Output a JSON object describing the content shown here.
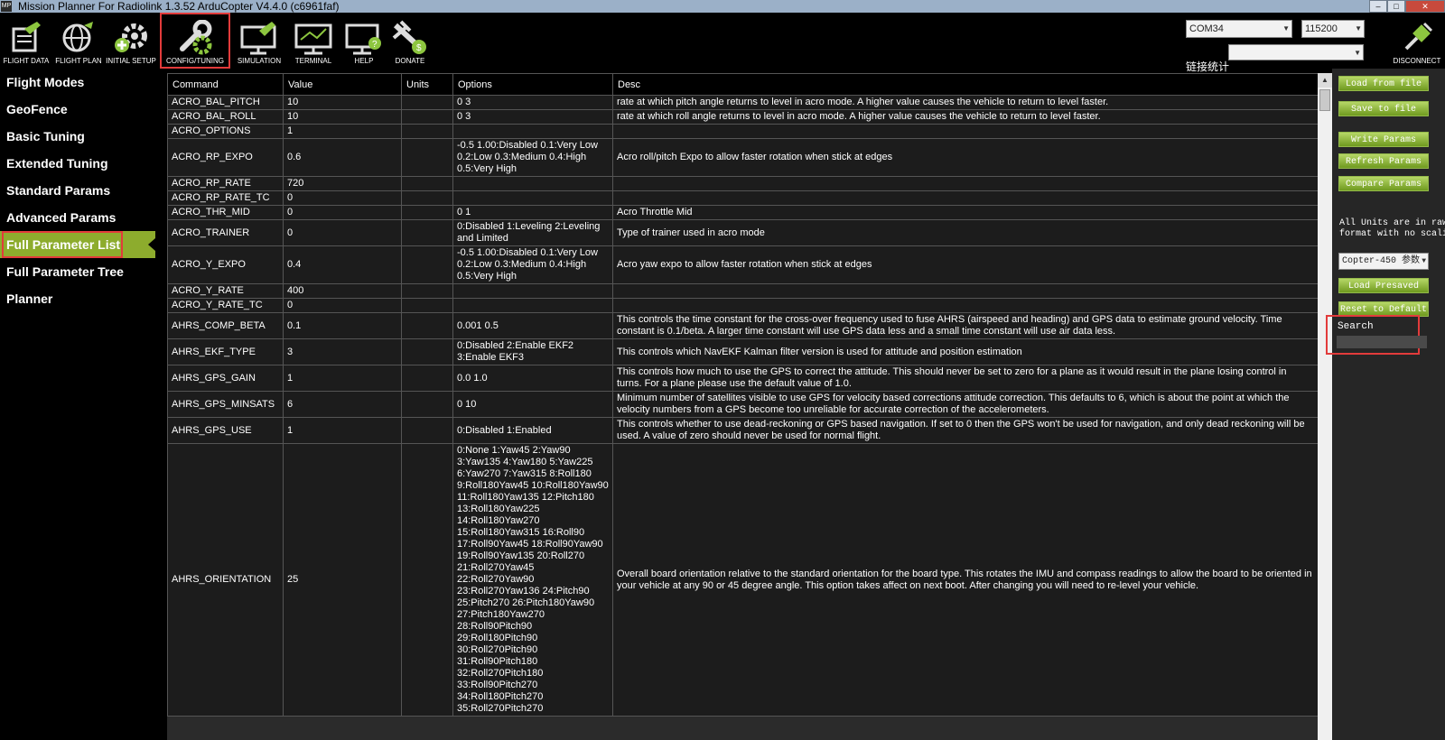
{
  "window": {
    "title": "Mission Planner For Radiolink 1.3.52 ArduCopter V4.4.0 (c6961faf)",
    "app_icon": "MP"
  },
  "toolbar": {
    "buttons": [
      {
        "label": "FLIGHT DATA",
        "icon": "flight-data-icon"
      },
      {
        "label": "FLIGHT PLAN",
        "icon": "flight-plan-icon"
      },
      {
        "label": "INITIAL SETUP",
        "icon": "initial-setup-icon"
      },
      {
        "label": "CONFIG/TUNING",
        "icon": "config-tuning-icon"
      },
      {
        "label": "SIMULATION",
        "icon": "simulation-icon"
      },
      {
        "label": "TERMINAL",
        "icon": "terminal-icon"
      },
      {
        "label": "HELP",
        "icon": "help-icon"
      },
      {
        "label": "DONATE",
        "icon": "donate-icon"
      }
    ],
    "port": "COM34",
    "baud": "115200",
    "stats_label": "链接统计",
    "disconnect_label": "DISCONNECT"
  },
  "sidebar": {
    "items": [
      {
        "label": "Flight Modes"
      },
      {
        "label": "GeoFence"
      },
      {
        "label": "Basic Tuning"
      },
      {
        "label": "Extended Tuning"
      },
      {
        "label": "Standard Params"
      },
      {
        "label": "Advanced Params"
      },
      {
        "label": "Full Parameter List"
      },
      {
        "label": "Full Parameter Tree"
      },
      {
        "label": "Planner"
      }
    ]
  },
  "grid": {
    "columns": [
      "Command",
      "Value",
      "Units",
      "Options",
      "Desc"
    ],
    "rows": [
      {
        "command": "ACRO_BAL_PITCH",
        "value": "10",
        "units": "",
        "options": "0 3",
        "desc": "rate at which pitch angle returns to level in acro mode.  A higher value causes the vehicle to return to level faster."
      },
      {
        "command": "ACRO_BAL_ROLL",
        "value": "10",
        "units": "",
        "options": "0 3",
        "desc": "rate at which roll angle returns to level in acro mode.  A higher value causes the vehicle to return to level faster."
      },
      {
        "command": "ACRO_OPTIONS",
        "value": "1",
        "units": "",
        "options": "",
        "desc": ""
      },
      {
        "command": "ACRO_RP_EXPO",
        "value": "0.6",
        "units": "",
        "options": "-0.5 1.00:Disabled 0.1:Very Low\n0.2:Low 0.3:Medium 0.4:High\n0.5:Very High",
        "desc": "Acro roll/pitch Expo to allow faster rotation when stick at edges"
      },
      {
        "command": "ACRO_RP_RATE",
        "value": "720",
        "units": "",
        "options": "",
        "desc": ""
      },
      {
        "command": "ACRO_RP_RATE_TC",
        "value": "0",
        "units": "",
        "options": "",
        "desc": ""
      },
      {
        "command": "ACRO_THR_MID",
        "value": "0",
        "units": "",
        "options": "0 1",
        "desc": "Acro Throttle Mid"
      },
      {
        "command": "ACRO_TRAINER",
        "value": "0",
        "units": "",
        "options": "0:Disabled 1:Leveling 2:Leveling\nand Limited",
        "desc": "Type of trainer used in acro mode"
      },
      {
        "command": "ACRO_Y_EXPO",
        "value": "0.4",
        "units": "",
        "options": "-0.5 1.00:Disabled 0.1:Very Low\n0.2:Low 0.3:Medium 0.4:High\n0.5:Very High",
        "desc": "Acro yaw expo to allow faster rotation when stick at edges"
      },
      {
        "command": "ACRO_Y_RATE",
        "value": "400",
        "units": "",
        "options": "",
        "desc": ""
      },
      {
        "command": "ACRO_Y_RATE_TC",
        "value": "0",
        "units": "",
        "options": "",
        "desc": ""
      },
      {
        "command": "AHRS_COMP_BETA",
        "value": "0.1",
        "units": "",
        "options": "0.001 0.5",
        "desc": "This controls the time constant for the cross-over frequency used to fuse AHRS (airspeed and heading) and GPS data to estimate ground velocity. Time constant is 0.1/beta. A larger time constant will use GPS data less and a small time constant will use air data less."
      },
      {
        "command": "AHRS_EKF_TYPE",
        "value": "3",
        "units": "",
        "options": "0:Disabled 2:Enable EKF2\n3:Enable EKF3",
        "desc": "This controls which NavEKF Kalman filter version is used for attitude and position estimation"
      },
      {
        "command": "AHRS_GPS_GAIN",
        "value": "1",
        "units": "",
        "options": "0.0 1.0",
        "desc": "This controls how much to use the GPS to correct the attitude. This should never be set to zero for a plane as it would result in the plane losing control in turns. For a plane please use the default value of 1.0."
      },
      {
        "command": "AHRS_GPS_MINSATS",
        "value": "6",
        "units": "",
        "options": "0 10",
        "desc": "Minimum number of satellites visible to use GPS for velocity based corrections attitude correction. This defaults to 6, which is about the point at which the velocity numbers from a GPS become too unreliable for accurate correction of the accelerometers."
      },
      {
        "command": "AHRS_GPS_USE",
        "value": "1",
        "units": "",
        "options": "0:Disabled 1:Enabled",
        "desc": "This controls whether to use dead-reckoning or GPS based navigation. If set to 0 then the GPS won't be used for navigation, and only dead reckoning will be used. A value of zero should never be used for normal flight."
      },
      {
        "command": "AHRS_ORIENTATION",
        "value": "25",
        "units": "",
        "options": "0:None 1:Yaw45 2:Yaw90\n3:Yaw135 4:Yaw180 5:Yaw225\n6:Yaw270 7:Yaw315 8:Roll180\n9:Roll180Yaw45 10:Roll180Yaw90\n11:Roll180Yaw135 12:Pitch180\n13:Roll180Yaw225\n14:Roll180Yaw270\n15:Roll180Yaw315 16:Roll90\n17:Roll90Yaw45 18:Roll90Yaw90\n19:Roll90Yaw135 20:Roll270\n21:Roll270Yaw45\n22:Roll270Yaw90\n23:Roll270Yaw136 24:Pitch90\n25:Pitch270 26:Pitch180Yaw90\n27:Pitch180Yaw270\n28:Roll90Pitch90\n29:Roll180Pitch90\n30:Roll270Pitch90\n31:Roll90Pitch180\n32:Roll270Pitch180\n33:Roll90Pitch270\n34:Roll180Pitch270\n35:Roll270Pitch270",
        "desc": "Overall board orientation relative to the standard orientation for the board type. This rotates the IMU and compass readings to allow the board to be oriented in your vehicle at any 90 or 45 degree angle. This option takes affect on next boot. After changing you will need to re-level your vehicle."
      }
    ]
  },
  "right_panel": {
    "load_file": "Load from file",
    "save_file": "Save to file",
    "write_params": "Write Params",
    "refresh_params": "Refresh Params",
    "compare_params": "Compare Params",
    "units_note": "All Units are in raw\nformat with no scaling",
    "preset_select": "Copter-450 参数",
    "load_presaved": "Load Presaved",
    "reset_default": "Reset to Default",
    "search_label": "Search",
    "search_value": ""
  },
  "colors": {
    "accent_green": "#8dac2d",
    "highlight_red": "#e23b3b",
    "selection_blue": "#3d7fd1"
  }
}
